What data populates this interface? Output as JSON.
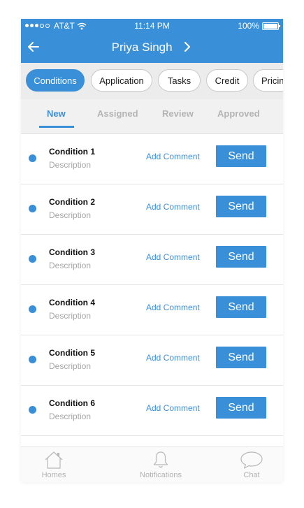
{
  "status_bar": {
    "carrier": "AT&T",
    "time": "11:14 PM",
    "battery": "100%"
  },
  "header": {
    "title": "Priya Singh"
  },
  "category_chips": [
    {
      "label": "Conditions",
      "active": true
    },
    {
      "label": "Application",
      "active": false
    },
    {
      "label": "Tasks",
      "active": false
    },
    {
      "label": "Credit",
      "active": false
    },
    {
      "label": "Pricing",
      "active": false
    }
  ],
  "status_tabs": [
    {
      "label": "New",
      "active": true
    },
    {
      "label": "Assigned",
      "active": false
    },
    {
      "label": "Review",
      "active": false
    },
    {
      "label": "Approved",
      "active": false
    }
  ],
  "conditions": [
    {
      "name": "Condition 1",
      "description": "Description",
      "comment_label": "Add Comment",
      "send_label": "Send"
    },
    {
      "name": "Condition 2",
      "description": "Description",
      "comment_label": "Add Comment",
      "send_label": "Send"
    },
    {
      "name": "Condition 3",
      "description": "Description",
      "comment_label": "Add Comment",
      "send_label": "Send"
    },
    {
      "name": "Condition 4",
      "description": "Description",
      "comment_label": "Add Comment",
      "send_label": "Send"
    },
    {
      "name": "Condition 5",
      "description": "Description",
      "comment_label": "Add Comment",
      "send_label": "Send"
    },
    {
      "name": "Condition 6",
      "description": "Description",
      "comment_label": "Add Comment",
      "send_label": "Send"
    }
  ],
  "bottom_nav": [
    {
      "label": "Homes",
      "icon": "home-icon"
    },
    {
      "label": "Notifications",
      "icon": "bell-icon"
    },
    {
      "label": "Chat",
      "icon": "chat-bubble-icon"
    }
  ],
  "colors": {
    "primary": "#3a90d8",
    "chip_bar": "#ececec",
    "muted": "#a6a6a6"
  }
}
